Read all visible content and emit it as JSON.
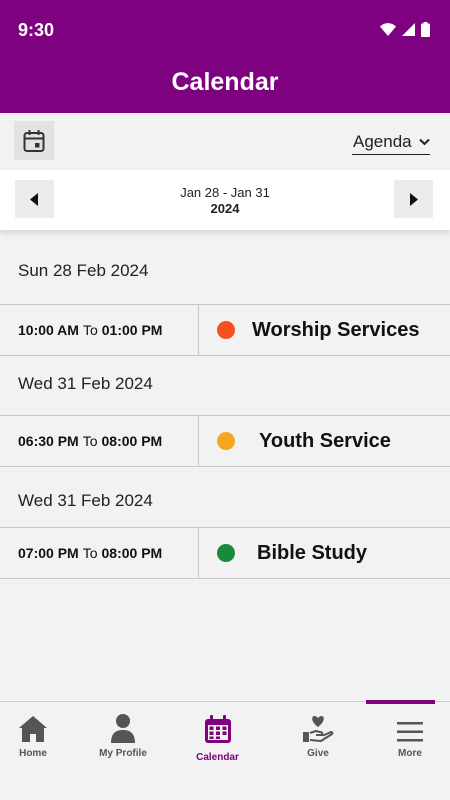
{
  "status": {
    "time": "9:30"
  },
  "header": {
    "title": "Calendar"
  },
  "toolbar": {
    "view_selected": "Agenda"
  },
  "date_nav": {
    "range": "Jan 28 - Jan 31",
    "year": "2024"
  },
  "agenda": [
    {
      "day": "Sun 28 Feb 2024",
      "start": "10:00 AM",
      "to": "To",
      "end": "01:00 PM",
      "title": "Worship Services",
      "color": "#f4511e"
    },
    {
      "day": "Wed 31 Feb 2024",
      "start": "06:30 PM",
      "to": "To",
      "end": "08:00 PM",
      "title": "Youth Service",
      "color": "#f6a623"
    },
    {
      "day": "Wed 31 Feb 2024",
      "start": "07:00 PM",
      "to": "To",
      "end": "08:00 PM",
      "title": "Bible Study",
      "color": "#178a3c"
    }
  ],
  "bottom_nav": {
    "home": "Home",
    "profile": "My Profile",
    "calendar": "Calendar",
    "give": "Give",
    "more": "More"
  },
  "colors": {
    "brand": "#7e0280",
    "background": "#f2f2f2"
  },
  "icons": [
    "wifi-icon",
    "signal-icon",
    "battery-icon",
    "calendar-icon",
    "chevron-down-icon",
    "arrow-left-icon",
    "arrow-right-icon",
    "home-icon",
    "person-icon",
    "calendar-grid-icon",
    "hand-heart-icon",
    "menu-icon"
  ]
}
